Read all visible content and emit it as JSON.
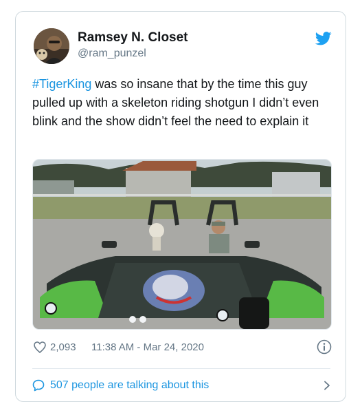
{
  "user": {
    "display_name": "Ramsey N. Closet",
    "handle": "@ram_punzel"
  },
  "tweet": {
    "hashtag": "#TigerKing",
    "text": " was so insane that by the time this guy pulled up with a skeleton riding shotgun I didn’t even blink and the show didn’t feel the need to explain it"
  },
  "meta": {
    "like_count": "2,093",
    "timestamp": "11:38 AM - Mar 24, 2020"
  },
  "footer": {
    "talking_text": "507 people are talking about this"
  },
  "icons": {
    "brand": "twitter-bird-icon",
    "like": "heart-icon",
    "info": "info-icon",
    "reply": "chat-bubble-icon",
    "more": "chevron-right-icon"
  },
  "colors": {
    "brand_blue": "#1da1f2",
    "link_blue": "#1b95e0",
    "muted_text": "#657786",
    "border": "#cfd9de"
  }
}
